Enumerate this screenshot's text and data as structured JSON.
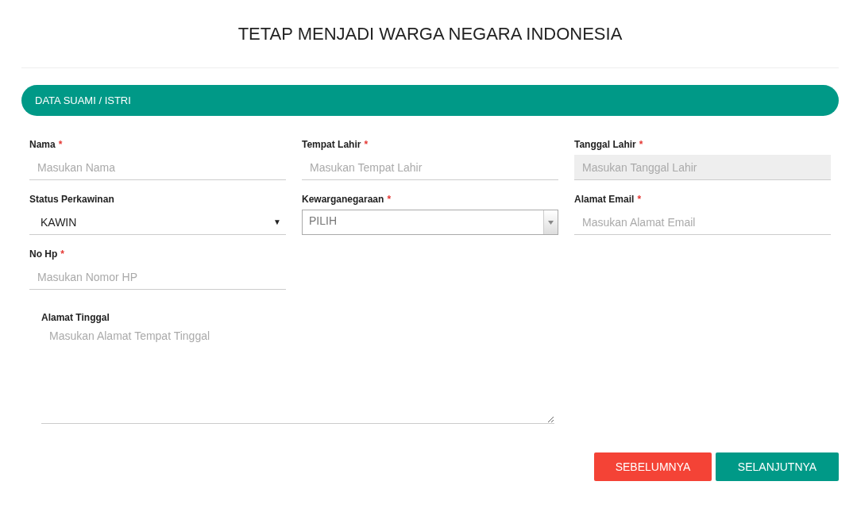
{
  "title": "TETAP MENJADI WARGA NEGARA INDONESIA",
  "section": {
    "title": "DATA SUAMI / ISTRI"
  },
  "fields": [
    {
      "label": "Nama",
      "required_mark": "*",
      "kind": "text",
      "placeholder": "Masukan Nama",
      "disabled": false
    },
    {
      "label": "Tempat Lahir",
      "required_mark": "*",
      "kind": "text",
      "placeholder": "Masukan Tempat Lahir",
      "disabled": false
    },
    {
      "label": "Tanggal Lahir",
      "required_mark": "*",
      "kind": "text",
      "placeholder": "Masukan Tanggal Lahir",
      "disabled": true
    },
    {
      "label": "Status Perkawinan",
      "kind": "select",
      "value": "KAWIN",
      "caret": "▼",
      "disabled": false
    },
    {
      "label": "Kewarganegaraan",
      "required_mark": "*",
      "kind": "dropdown",
      "value": "PILIH",
      "disabled": false
    },
    {
      "label": "Alamat Email",
      "required_mark": "*",
      "kind": "text",
      "placeholder": "Masukan Alamat Email",
      "disabled": false
    },
    {
      "label": "No Hp",
      "required_mark": "*",
      "kind": "text",
      "placeholder": "Masukan Nomor HP",
      "disabled": false
    }
  ],
  "address": {
    "label": "Alamat Tinggal",
    "placeholder": "Masukan Alamat Tempat Tinggal"
  },
  "buttons": [
    {
      "label": "SEBELUMNYA",
      "kind": "back"
    },
    {
      "label": "SELANJUTNYA",
      "kind": "next"
    }
  ]
}
